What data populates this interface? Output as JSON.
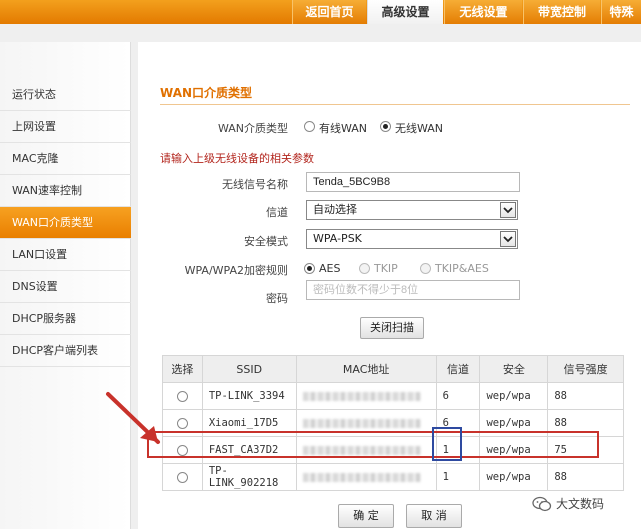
{
  "tabs": [
    {
      "label": "返回首页",
      "active": false
    },
    {
      "label": "高级设置",
      "active": true
    },
    {
      "label": "无线设置",
      "active": false
    },
    {
      "label": "带宽控制",
      "active": false
    },
    {
      "label": "特殊",
      "active": false
    }
  ],
  "sidebar": {
    "items": [
      {
        "label": "运行状态"
      },
      {
        "label": "上网设置"
      },
      {
        "label": "MAC克隆"
      },
      {
        "label": "WAN速率控制"
      },
      {
        "label": "WAN口介质类型",
        "active": true
      },
      {
        "label": "LAN口设置"
      },
      {
        "label": "DNS设置"
      },
      {
        "label": "DHCP服务器"
      },
      {
        "label": "DHCP客户端列表"
      }
    ]
  },
  "form": {
    "section_title": "WAN口介质类型",
    "media_label": "WAN介质类型",
    "media_options": [
      "有线WAN",
      "无线WAN"
    ],
    "media_selected": "无线WAN",
    "notice": "请输入上级无线设备的相关参数",
    "ssid_label": "无线信号名称",
    "ssid_value": "Tenda_5BC9B8",
    "channel_label": "信道",
    "channel_value": "自动选择",
    "security_label": "安全模式",
    "security_value": "WPA-PSK",
    "cipher_label": "WPA/WPA2加密规则",
    "cipher_options": [
      "AES",
      "TKIP",
      "TKIP&AES"
    ],
    "cipher_selected": "AES",
    "password_label": "密码",
    "password_placeholder": "密码位数不得少于8位",
    "scan_button": "关闭扫描"
  },
  "table": {
    "headers": [
      "选择",
      "SSID",
      "MAC地址",
      "信道",
      "安全",
      "信号强度"
    ],
    "rows": [
      {
        "ssid": "TP-LINK_3394",
        "channel": "6",
        "security": "wep/wpa",
        "signal": "88"
      },
      {
        "ssid": "Xiaomi_17D5",
        "channel": "6",
        "security": "wep/wpa",
        "signal": "88"
      },
      {
        "ssid": "FAST_CA37D2",
        "channel": "1",
        "security": "wep/wpa",
        "signal": "75"
      },
      {
        "ssid": "TP-LINK_902218",
        "channel": "1",
        "security": "wep/wpa",
        "signal": "88"
      }
    ]
  },
  "buttons": {
    "ok": "确 定",
    "cancel": "取 消"
  },
  "watermark": {
    "text": "大文数码"
  },
  "colors": {
    "accent": "#e97f00",
    "annotation_red": "#c8322b",
    "annotation_blue": "#2e4aa0"
  }
}
